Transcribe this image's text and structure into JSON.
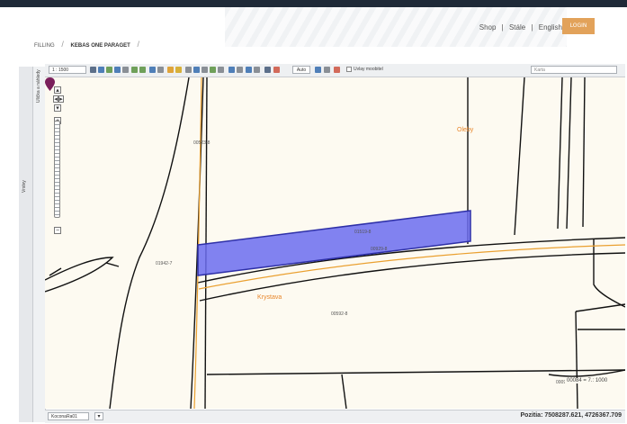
{
  "header": {
    "links": [
      "Shop",
      "Stále",
      "English"
    ],
    "separator": "|",
    "login_label": "LOGIN"
  },
  "breadcrumb": {
    "items": [
      "FILLING",
      "KEBAS ONE PARAGET"
    ],
    "separator": "/"
  },
  "sidebar": {
    "panel_label": "Vrstvy",
    "tab_label": "Ulička a náhledy"
  },
  "toolbar": {
    "scale_value": "1 : 1500",
    "layer_value": "Auto",
    "checkbox_label": "Uvlay moobitel",
    "search_placeholder": "Karta"
  },
  "zoom": {
    "zoom_in": "+",
    "zoom_out": "−"
  },
  "map": {
    "parcel_labels": [
      "00523-8",
      "01519-8",
      "00929-8",
      "01942-7",
      "00592-8",
      "00094-7"
    ],
    "place_names": [
      "Oleby",
      "Krystava"
    ],
    "scale_text": "00084 = 7.: 1000",
    "colors": {
      "highlight_fill": "#6b6cf0",
      "highlight_stroke": "#2e30a8",
      "road": "#eaa030",
      "parcel_line": "#111111",
      "background": "#fdfaf1",
      "pin": "#7a1f5c",
      "place_label": "#e8862a"
    }
  },
  "status": {
    "projection": "KoconaRa01",
    "coordinates": "Pozitia: 7508287.621, 4726367.709"
  }
}
